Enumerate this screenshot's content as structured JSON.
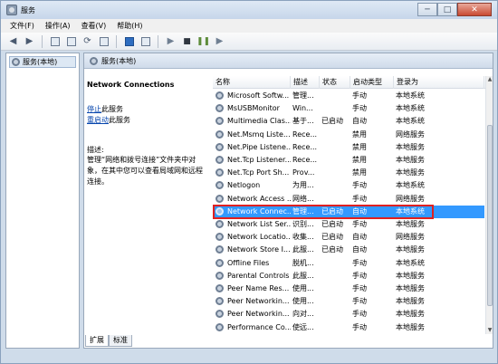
{
  "window": {
    "title": "服务",
    "minimize": "─",
    "maximize": "□",
    "close": "✕"
  },
  "menu": [
    "文件(F)",
    "操作(A)",
    "查看(V)",
    "帮助(H)"
  ],
  "tree": {
    "root_label": "服务(本地)"
  },
  "main": {
    "header_label": "服务(本地)",
    "selected_service_name": "Network Connections",
    "stop_link": "停止",
    "stop_suffix": "此服务",
    "restart_link": "重启动",
    "restart_suffix": "此服务",
    "description_label": "描述:",
    "description_text": "管理“网络和拨号连接”文件夹中对象，在其中您可以查看局域网和远程连接。"
  },
  "columns": [
    "名称",
    "描述",
    "状态",
    "启动类型",
    "登录为"
  ],
  "rows": [
    {
      "name": "Microsoft Softw...",
      "desc": "管理...",
      "status": "",
      "startup": "手动",
      "logon": "本地系统"
    },
    {
      "name": "MsUSBMonitor",
      "desc": "Win...",
      "status": "",
      "startup": "手动",
      "logon": "本地系统"
    },
    {
      "name": "Multimedia Clas...",
      "desc": "基于...",
      "status": "已启动",
      "startup": "自动",
      "logon": "本地系统"
    },
    {
      "name": "Net.Msmq Liste...",
      "desc": "Rece...",
      "status": "",
      "startup": "禁用",
      "logon": "网络服务"
    },
    {
      "name": "Net.Pipe Listene...",
      "desc": "Rece...",
      "status": "",
      "startup": "禁用",
      "logon": "本地服务"
    },
    {
      "name": "Net.Tcp Listener...",
      "desc": "Rece...",
      "status": "",
      "startup": "禁用",
      "logon": "本地服务"
    },
    {
      "name": "Net.Tcp Port Sh...",
      "desc": "Prov...",
      "status": "",
      "startup": "禁用",
      "logon": "本地服务"
    },
    {
      "name": "Netlogon",
      "desc": "为用...",
      "status": "",
      "startup": "手动",
      "logon": "本地系统"
    },
    {
      "name": "Network Access ...",
      "desc": "网络...",
      "status": "",
      "startup": "手动",
      "logon": "网络服务"
    },
    {
      "name": "Network Connec...",
      "desc": "管理...",
      "status": "已启动",
      "startup": "自动",
      "logon": "本地系统"
    },
    {
      "name": "Network List Ser...",
      "desc": "识别...",
      "status": "已启动",
      "startup": "手动",
      "logon": "本地服务"
    },
    {
      "name": "Network Locatio...",
      "desc": "收集...",
      "status": "已启动",
      "startup": "自动",
      "logon": "网络服务"
    },
    {
      "name": "Network Store I...",
      "desc": "此服...",
      "status": "已启动",
      "startup": "自动",
      "logon": "本地服务"
    },
    {
      "name": "Offline Files",
      "desc": "脱机...",
      "status": "",
      "startup": "手动",
      "logon": "本地系统"
    },
    {
      "name": "Parental Controls",
      "desc": "此服...",
      "status": "",
      "startup": "手动",
      "logon": "本地服务"
    },
    {
      "name": "Peer Name Res...",
      "desc": "使用...",
      "status": "",
      "startup": "手动",
      "logon": "本地服务"
    },
    {
      "name": "Peer Networkin...",
      "desc": "使用...",
      "status": "",
      "startup": "手动",
      "logon": "本地服务"
    },
    {
      "name": "Peer Networkin...",
      "desc": "向对...",
      "status": "",
      "startup": "手动",
      "logon": "本地服务"
    },
    {
      "name": "Performance Co...",
      "desc": "使远...",
      "status": "",
      "startup": "手动",
      "logon": "本地服务"
    }
  ],
  "selected_row_index": 9,
  "tabs": [
    "扩展",
    "标准"
  ],
  "colors": {
    "selection": "#3399ff",
    "highlight_border": "#e02020"
  },
  "icons": [
    "back-arrow-icon",
    "forward-arrow-icon",
    "console-tree-icon",
    "properties-icon",
    "refresh-icon",
    "export-icon",
    "help-icon",
    "view-icon",
    "start-service-icon",
    "stop-service-icon",
    "pause-service-icon",
    "restart-service-icon",
    "service-gear-icon"
  ]
}
